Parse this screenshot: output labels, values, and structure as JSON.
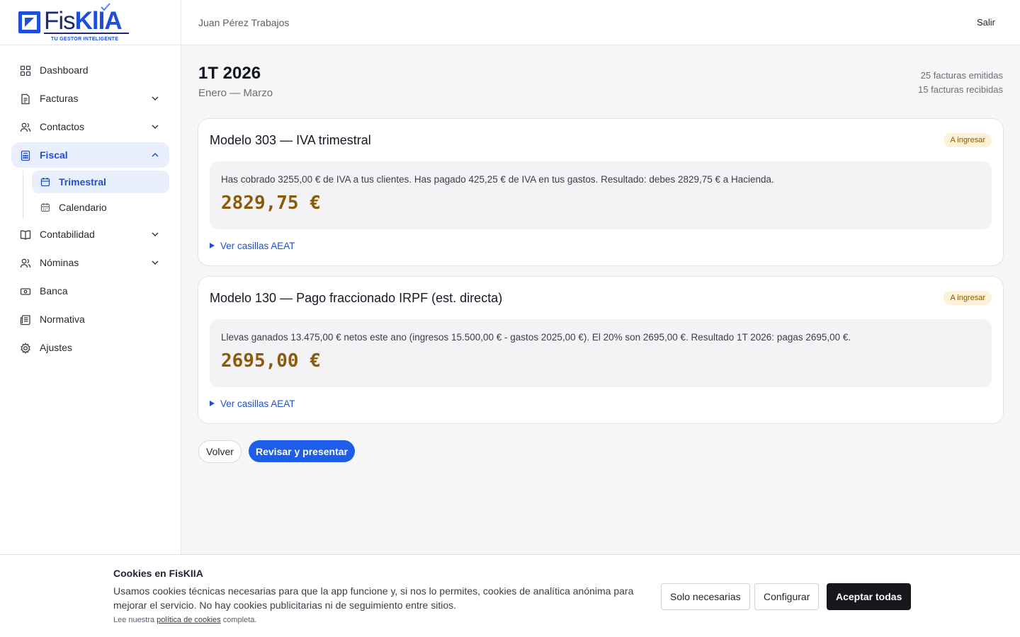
{
  "brand": {
    "name_light": "Fis",
    "name_bold": "KlIA",
    "tagline": "TU GESTOR INTELIGENTE"
  },
  "user": {
    "name": "Juan Pérez Trabajos",
    "logout_label": "Salir"
  },
  "sidebar": {
    "items": [
      {
        "label": "Dashboard",
        "icon": "grid-icon"
      },
      {
        "label": "Facturas",
        "icon": "file-icon"
      },
      {
        "label": "Contactos",
        "icon": "users-icon"
      },
      {
        "label": "Fiscal",
        "icon": "calculator-icon"
      },
      {
        "label": "Contabilidad",
        "icon": "book-icon"
      },
      {
        "label": "Nóminas",
        "icon": "users-icon"
      },
      {
        "label": "Banca",
        "icon": "banknote-icon"
      },
      {
        "label": "Normativa",
        "icon": "newspaper-icon"
      },
      {
        "label": "Ajustes",
        "icon": "gear-icon"
      }
    ],
    "fiscal_sub": [
      {
        "label": "Trimestral",
        "icon": "calendar-icon"
      },
      {
        "label": "Calendario",
        "icon": "calendar-icon"
      }
    ],
    "active_color": "#1e4fd8"
  },
  "period": {
    "title": "1T 2026",
    "range": "Enero — Marzo",
    "issued": "25 facturas emitidas",
    "received": "15 facturas recibidas"
  },
  "cards": [
    {
      "title": "Modelo 303 — IVA trimestral",
      "badge": "A ingresar",
      "summary": "Has cobrado 3255,00 € de IVA a tus clientes. Has pagado 425,25 € de IVA en tus gastos. Resultado: debes 2829,75 € a Hacienda.",
      "amount": "2829,75 €",
      "details_label": "Ver casillas AEAT"
    },
    {
      "title": "Modelo 130 — Pago fraccionado IRPF (est. directa)",
      "badge": "A ingresar",
      "summary": "Llevas ganados 13.475,00 € netos este ano (ingresos 15.500,00 € - gastos 2025,00 €). El 20% son 2695,00 €. Resultado 1T 2026: pagas 2695,00 €.",
      "amount": "2695,00 €",
      "details_label": "Ver casillas AEAT"
    }
  ],
  "actions": {
    "back": "Volver",
    "submit": "Revisar y presentar"
  },
  "cookie": {
    "title": "Cookies en FisKIIA",
    "body": "Usamos cookies técnicas necesarias para que la app funcione y, si nos lo permites, cookies de analítica anónima para mejorar el servicio. No hay cookies publicitarias ni de seguimiento entre sitios.",
    "note_prefix": "Lee nuestra",
    "note_link": "política de cookies",
    "note_suffix": "completa.",
    "btn_necessary": "Solo necesarias",
    "btn_configure": "Configurar",
    "btn_accept": "Aceptar todas"
  }
}
